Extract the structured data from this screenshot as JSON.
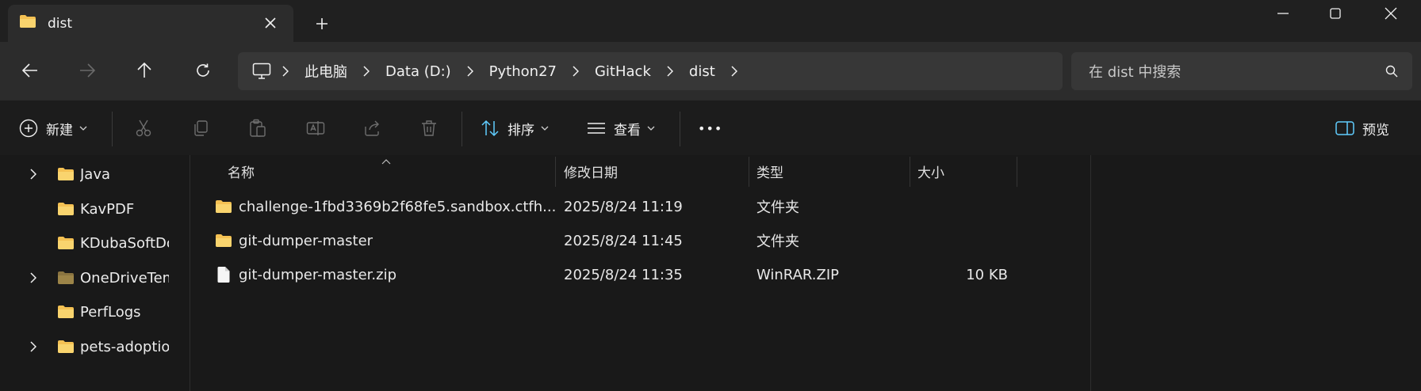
{
  "window": {
    "tab_title": "dist",
    "new_tab_glyph": "+",
    "controls": [
      "minimize-icon",
      "maximize-icon",
      "close-icon"
    ]
  },
  "address_bar": {
    "breadcrumbs": [
      "此电脑",
      "Data (D:)",
      "Python27",
      "GitHack",
      "dist"
    ],
    "search_placeholder": "在 dist 中搜索"
  },
  "command_bar": {
    "new_label": "新建",
    "sort_label": "排序",
    "view_label": "查看",
    "more_label": "•••",
    "preview_label": "预览"
  },
  "nav_tree": [
    {
      "label": "Java",
      "expandable": true
    },
    {
      "label": "KavPDF",
      "expandable": false
    },
    {
      "label": "KDubaSoftDownloads",
      "expandable": false
    },
    {
      "label": "OneDriveTemp",
      "expandable": true
    },
    {
      "label": "PerfLogs",
      "expandable": false
    },
    {
      "label": "pets-adoption",
      "expandable": true
    }
  ],
  "columns": {
    "name": "名称",
    "modified": "修改日期",
    "type": "类型",
    "size": "大小"
  },
  "files": [
    {
      "name": "challenge-1fbd3369b2f68fe5.sandbox.ctfh...",
      "modified": "2025/8/24 11:19",
      "type": "文件夹",
      "size": "",
      "icon": "folder-icon"
    },
    {
      "name": "git-dumper-master",
      "modified": "2025/8/24 11:45",
      "type": "文件夹",
      "size": "",
      "icon": "folder-icon"
    },
    {
      "name": "git-dumper-master.zip",
      "modified": "2025/8/24 11:35",
      "type": "WinRAR.ZIP",
      "size": "10 KB",
      "icon": "file-icon"
    }
  ],
  "colors": {
    "folder": "#f4c153",
    "accent": "#60cdff"
  }
}
